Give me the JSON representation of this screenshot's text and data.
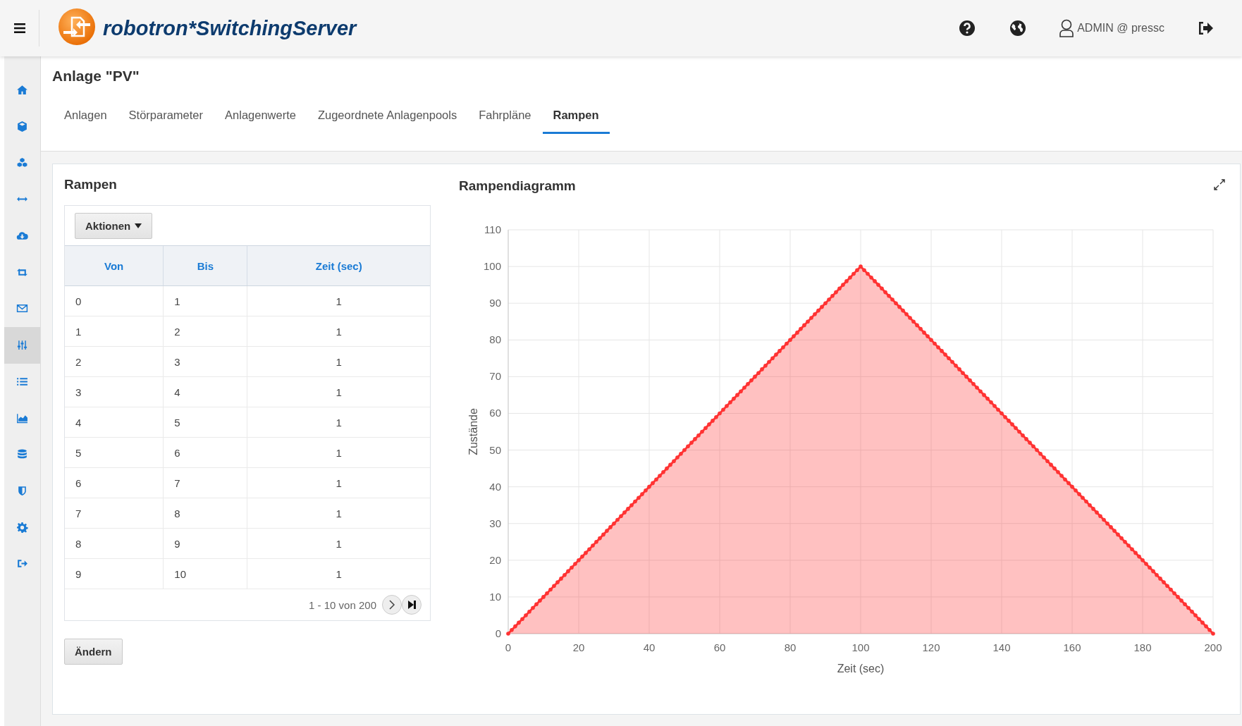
{
  "header": {
    "brand": "robotron*SwitchingServer",
    "user": "ADMIN @ pressc"
  },
  "sidebar": {
    "items": [
      {
        "selected": false
      },
      {
        "selected": false
      },
      {
        "selected": false
      },
      {
        "selected": false
      },
      {
        "selected": false
      },
      {
        "selected": false
      },
      {
        "selected": false
      },
      {
        "selected": true
      },
      {
        "selected": false
      },
      {
        "selected": false
      },
      {
        "selected": false
      },
      {
        "selected": false
      },
      {
        "selected": false
      },
      {
        "selected": false
      }
    ]
  },
  "page": {
    "title": "Anlage \"PV\""
  },
  "tabs": [
    {
      "label": "Anlagen",
      "selected": false
    },
    {
      "label": "Störparameter",
      "selected": false
    },
    {
      "label": "Anlagenwerte",
      "selected": false
    },
    {
      "label": "Zugeordnete Anlagenpools",
      "selected": false
    },
    {
      "label": "Fahrpläne",
      "selected": false
    },
    {
      "label": "Rampen",
      "selected": true
    }
  ],
  "ramps": {
    "title": "Rampen",
    "actions_button": "Aktionen",
    "columns": [
      "Von",
      "Bis",
      "Zeit (sec)"
    ],
    "rows": [
      [
        "0",
        "1",
        "1"
      ],
      [
        "1",
        "2",
        "1"
      ],
      [
        "2",
        "3",
        "1"
      ],
      [
        "3",
        "4",
        "1"
      ],
      [
        "4",
        "5",
        "1"
      ],
      [
        "5",
        "6",
        "1"
      ],
      [
        "6",
        "7",
        "1"
      ],
      [
        "7",
        "8",
        "1"
      ],
      [
        "8",
        "9",
        "1"
      ],
      [
        "9",
        "10",
        "1"
      ]
    ],
    "pagination": "1 - 10 von 200",
    "edit_button": "Ändern"
  },
  "diagram": {
    "title": "Rampendiagramm",
    "chart_data": {
      "type": "area",
      "grid": true,
      "xlabel": "Zeit (sec)",
      "ylabel": "Zustände",
      "xlim": [
        0,
        200
      ],
      "ylim": [
        0,
        110
      ],
      "xticks": [
        0,
        20,
        40,
        60,
        80,
        100,
        120,
        140,
        160,
        180,
        200
      ],
      "yticks": [
        0,
        10,
        20,
        30,
        40,
        50,
        60,
        70,
        80,
        90,
        100,
        110
      ],
      "x": [
        0,
        1,
        2,
        3,
        4,
        5,
        6,
        7,
        8,
        9,
        10,
        11,
        12,
        13,
        14,
        15,
        16,
        17,
        18,
        19,
        20,
        21,
        22,
        23,
        24,
        25,
        26,
        27,
        28,
        29,
        30,
        31,
        32,
        33,
        34,
        35,
        36,
        37,
        38,
        39,
        40,
        41,
        42,
        43,
        44,
        45,
        46,
        47,
        48,
        49,
        50,
        51,
        52,
        53,
        54,
        55,
        56,
        57,
        58,
        59,
        60,
        61,
        62,
        63,
        64,
        65,
        66,
        67,
        68,
        69,
        70,
        71,
        72,
        73,
        74,
        75,
        76,
        77,
        78,
        79,
        80,
        81,
        82,
        83,
        84,
        85,
        86,
        87,
        88,
        89,
        90,
        91,
        92,
        93,
        94,
        95,
        96,
        97,
        98,
        99,
        100,
        101,
        102,
        103,
        104,
        105,
        106,
        107,
        108,
        109,
        110,
        111,
        112,
        113,
        114,
        115,
        116,
        117,
        118,
        119,
        120,
        121,
        122,
        123,
        124,
        125,
        126,
        127,
        128,
        129,
        130,
        131,
        132,
        133,
        134,
        135,
        136,
        137,
        138,
        139,
        140,
        141,
        142,
        143,
        144,
        145,
        146,
        147,
        148,
        149,
        150,
        151,
        152,
        153,
        154,
        155,
        156,
        157,
        158,
        159,
        160,
        161,
        162,
        163,
        164,
        165,
        166,
        167,
        168,
        169,
        170,
        171,
        172,
        173,
        174,
        175,
        176,
        177,
        178,
        179,
        180,
        181,
        182,
        183,
        184,
        185,
        186,
        187,
        188,
        189,
        190,
        191,
        192,
        193,
        194,
        195,
        196,
        197,
        198,
        199,
        200
      ],
      "series": [
        {
          "color": "#ff3333",
          "values": [
            0,
            1,
            2,
            3,
            4,
            5,
            6,
            7,
            8,
            9,
            10,
            11,
            12,
            13,
            14,
            15,
            16,
            17,
            18,
            19,
            20,
            21,
            22,
            23,
            24,
            25,
            26,
            27,
            28,
            29,
            30,
            31,
            32,
            33,
            34,
            35,
            36,
            37,
            38,
            39,
            40,
            41,
            42,
            43,
            44,
            45,
            46,
            47,
            48,
            49,
            50,
            51,
            52,
            53,
            54,
            55,
            56,
            57,
            58,
            59,
            60,
            61,
            62,
            63,
            64,
            65,
            66,
            67,
            68,
            69,
            70,
            71,
            72,
            73,
            74,
            75,
            76,
            77,
            78,
            79,
            80,
            81,
            82,
            83,
            84,
            85,
            86,
            87,
            88,
            89,
            90,
            91,
            92,
            93,
            94,
            95,
            96,
            97,
            98,
            99,
            100,
            99,
            98,
            97,
            96,
            95,
            94,
            93,
            92,
            91,
            90,
            89,
            88,
            87,
            86,
            85,
            84,
            83,
            82,
            81,
            80,
            79,
            78,
            77,
            76,
            75,
            74,
            73,
            72,
            71,
            70,
            69,
            68,
            67,
            66,
            65,
            64,
            63,
            62,
            61,
            60,
            59,
            58,
            57,
            56,
            55,
            54,
            53,
            52,
            51,
            50,
            49,
            48,
            47,
            46,
            45,
            44,
            43,
            42,
            41,
            40,
            39,
            38,
            37,
            36,
            35,
            34,
            33,
            32,
            31,
            30,
            29,
            28,
            27,
            26,
            25,
            24,
            23,
            22,
            21,
            20,
            19,
            18,
            17,
            16,
            15,
            14,
            13,
            12,
            11,
            10,
            9,
            8,
            7,
            6,
            5,
            4,
            3,
            2,
            1,
            0
          ]
        }
      ]
    }
  }
}
